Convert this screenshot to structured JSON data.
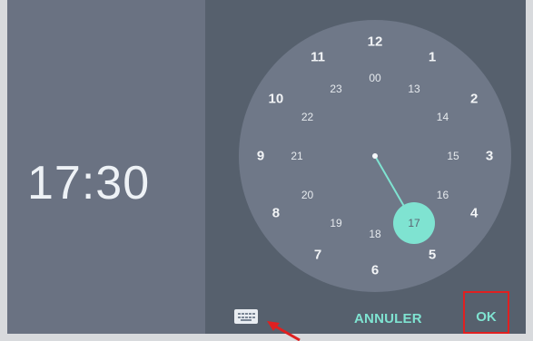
{
  "time_display": "17:30",
  "clock": {
    "outer": [
      "12",
      "1",
      "2",
      "3",
      "4",
      "5",
      "6",
      "7",
      "8",
      "9",
      "10",
      "11"
    ],
    "inner": [
      "00",
      "13",
      "14",
      "15",
      "16",
      "17",
      "18",
      "19",
      "20",
      "21",
      "22",
      "23"
    ],
    "selected_hour": "17"
  },
  "buttons": {
    "cancel": "ANNULER",
    "ok": "OK"
  },
  "icons": {
    "keyboard": "keyboard-icon"
  },
  "colors": {
    "accent": "#7fe3d1",
    "highlight_box": "#e02020"
  }
}
